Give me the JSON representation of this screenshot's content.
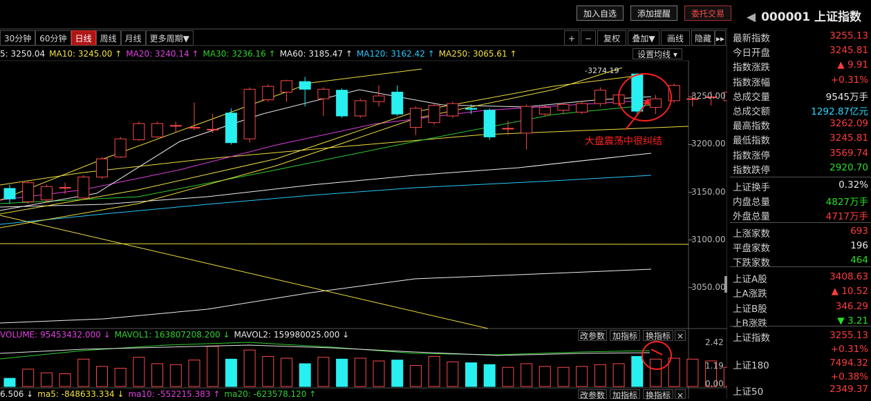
{
  "toolbar": {
    "add_watch": "加入自选",
    "add_alert": "添加提醒",
    "trade": "委托交易"
  },
  "security": {
    "code": "000001",
    "name": "上证指数"
  },
  "tabs": [
    {
      "label": "30分钟"
    },
    {
      "label": "60分钟"
    },
    {
      "label": "日线",
      "active": true
    },
    {
      "label": "周线"
    },
    {
      "label": "月线"
    },
    {
      "label": "更多周期▼"
    }
  ],
  "right_tools": {
    "plus": "+",
    "minus": "−",
    "restore": "复权",
    "overlay": "叠加▼",
    "draw": "画线",
    "hide": "隐藏",
    "more": "▸▸"
  },
  "ma_line": [
    {
      "text": "5: 3250.04",
      "color": "#e8e8e8"
    },
    {
      "text": "MA10: 3245.00 ↑",
      "color": "#f0e040"
    },
    {
      "text": "MA20: 3240.14 ↑",
      "color": "#e040e0"
    },
    {
      "text": "MA30: 3236.16 ↑",
      "color": "#30d030"
    },
    {
      "text": "MA60: 3185.47 ↑",
      "color": "#e8e8e8"
    },
    {
      "text": "MA120: 3162.42 ↑",
      "color": "#28c8ff"
    },
    {
      "text": "MA250: 3065.61 ↑",
      "color": "#f0e040"
    }
  ],
  "ma_settings": "设置均线 ▾",
  "price_ticks": [
    "3250.00",
    "3200.00",
    "3150.00",
    "3100.00",
    "3050.00"
  ],
  "high_label": "3274.19",
  "annotation": "大盘震荡中很纠结",
  "volume_line": [
    {
      "text": "VOLUME: 95453432.000 ↓",
      "color": "#e040e0"
    },
    {
      "text": "MAVOL1: 163807208.200 ↓",
      "color": "#30d030"
    },
    {
      "text": "MAVOL2: 159980025.000 ↓",
      "color": "#e8e8e8"
    }
  ],
  "volume_ticks": [
    "2.42",
    "1.19",
    "0.00"
  ],
  "bottom_line": [
    {
      "text": "6.506 ↓",
      "color": "#e8e8e8"
    },
    {
      "text": "ma5: -848633.334 ↓",
      "color": "#f0e040"
    },
    {
      "text": "ma10: -552215.383 ↑",
      "color": "#e040e0"
    },
    {
      "text": "ma20: -623578.120 ↑",
      "color": "#30d030"
    }
  ],
  "mini_buttons": {
    "params": "改参数",
    "add_ind": "加指标",
    "swap_ind": "换指标",
    "close": "×"
  },
  "panel": [
    {
      "label": "最新指数",
      "value": "3255.13",
      "cls": "red"
    },
    {
      "label": "今日开盘",
      "value": "3245.81",
      "cls": "red"
    },
    {
      "label": "指数涨跌",
      "value": "▲ 9.91",
      "cls": "red"
    },
    {
      "label": "指数涨幅",
      "value": "+0.31%",
      "cls": "red"
    },
    {
      "label": "总成交量",
      "value": "9545万手",
      "cls": "white"
    },
    {
      "label": "总成交额",
      "value": "1292.87亿元",
      "cls": "cyan"
    },
    {
      "label": "最高指数",
      "value": "3262.09",
      "cls": "red"
    },
    {
      "label": "最低指数",
      "value": "3245.81",
      "cls": "red"
    },
    {
      "label": "指数涨停",
      "value": "3569.74",
      "cls": "red"
    },
    {
      "label": "指数跌停",
      "value": "2920.70",
      "cls": "green"
    },
    {
      "label": "上证换手",
      "value": "0.32%",
      "cls": "white"
    },
    {
      "label": "内盘总量",
      "value": "4827万手",
      "cls": "green"
    },
    {
      "label": "外盘总量",
      "value": "4717万手",
      "cls": "red"
    },
    {
      "label": "上涨家数",
      "value": "693",
      "cls": "red"
    },
    {
      "label": "平盘家数",
      "value": "196",
      "cls": "white"
    },
    {
      "label": "下跌家数",
      "value": "464",
      "cls": "green"
    },
    {
      "label": "上证A股",
      "value": "3408.63",
      "cls": "red"
    },
    {
      "label": "上A涨跌",
      "value": "▲ 10.52",
      "cls": "red"
    },
    {
      "label": "上证B股",
      "value": "346.29",
      "cls": "red"
    },
    {
      "label": "上B涨跌",
      "value": "▼ 3.21",
      "cls": "green"
    }
  ],
  "panel_bottom": [
    {
      "label": "上证指数",
      "value": "3255.13",
      "sub": "+0.31%"
    },
    {
      "label": "上证180",
      "value": "7494.32",
      "sub": "+0.38%"
    },
    {
      "label": "上证50",
      "value": "2349.37",
      "sub": ""
    }
  ],
  "chart_data": {
    "type": "candlestick",
    "price_range": [
      3010,
      3285
    ],
    "candles": [
      {
        "o": 3154,
        "c": 3143,
        "h": 3158,
        "l": 3138
      },
      {
        "o": 3140,
        "c": 3160,
        "h": 3162,
        "l": 3138
      },
      {
        "o": 3142,
        "c": 3156,
        "h": 3158,
        "l": 3139
      },
      {
        "o": 3155,
        "c": 3155,
        "h": 3160,
        "l": 3148
      },
      {
        "o": 3144,
        "c": 3166,
        "h": 3168,
        "l": 3143
      },
      {
        "o": 3166,
        "c": 3185,
        "h": 3187,
        "l": 3164
      },
      {
        "o": 3187,
        "c": 3206,
        "h": 3208,
        "l": 3186
      },
      {
        "o": 3205,
        "c": 3222,
        "h": 3224,
        "l": 3204
      },
      {
        "o": 3208,
        "c": 3222,
        "h": 3224,
        "l": 3207
      },
      {
        "o": 3220,
        "c": 3220,
        "h": 3224,
        "l": 3213
      },
      {
        "o": 3218,
        "c": 3218,
        "h": 3244,
        "l": 3215
      },
      {
        "o": 3216,
        "c": 3216,
        "h": 3232,
        "l": 3212
      },
      {
        "o": 3233,
        "c": 3202,
        "h": 3238,
        "l": 3200
      },
      {
        "o": 3206,
        "c": 3258,
        "h": 3260,
        "l": 3202
      },
      {
        "o": 3247,
        "c": 3261,
        "h": 3263,
        "l": 3245
      },
      {
        "o": 3255,
        "c": 3267,
        "h": 3268,
        "l": 3245
      },
      {
        "o": 3266,
        "c": 3258,
        "h": 3271,
        "l": 3240
      },
      {
        "o": 3248,
        "c": 3258,
        "h": 3260,
        "l": 3230
      },
      {
        "o": 3257,
        "c": 3230,
        "h": 3259,
        "l": 3228
      },
      {
        "o": 3230,
        "c": 3246,
        "h": 3248,
        "l": 3228
      },
      {
        "o": 3245,
        "c": 3251,
        "h": 3262,
        "l": 3240
      },
      {
        "o": 3255,
        "c": 3232,
        "h": 3262,
        "l": 3230
      },
      {
        "o": 3218,
        "c": 3238,
        "h": 3240,
        "l": 3210
      },
      {
        "o": 3223,
        "c": 3241,
        "h": 3243,
        "l": 3221
      },
      {
        "o": 3230,
        "c": 3243,
        "h": 3245,
        "l": 3228
      },
      {
        "o": 3238,
        "c": 3237,
        "h": 3242,
        "l": 3232
      },
      {
        "o": 3236,
        "c": 3208,
        "h": 3238,
        "l": 3205
      },
      {
        "o": 3217,
        "c": 3217,
        "h": 3225,
        "l": 3210
      },
      {
        "o": 3212,
        "c": 3240,
        "h": 3242,
        "l": 3195
      },
      {
        "o": 3232,
        "c": 3239,
        "h": 3241,
        "l": 3230
      },
      {
        "o": 3236,
        "c": 3242,
        "h": 3244,
        "l": 3232
      },
      {
        "o": 3234,
        "c": 3243,
        "h": 3245,
        "l": 3232
      },
      {
        "o": 3243,
        "c": 3257,
        "h": 3260,
        "l": 3240
      },
      {
        "o": 3243,
        "c": 3252,
        "h": 3254,
        "l": 3240
      },
      {
        "o": 3274,
        "c": 3235,
        "h": 3275,
        "l": 3232
      },
      {
        "o": 3239,
        "c": 3248,
        "h": 3252,
        "l": 3232
      },
      {
        "o": 3246,
        "c": 3262,
        "h": 3264,
        "l": 3244
      },
      {
        "o": 3248,
        "c": 3248,
        "h": 3254,
        "l": 3240
      },
      {
        "o": 3250,
        "c": 3250,
        "h": 3256,
        "l": 3241
      },
      {
        "o": 3246,
        "c": 3255,
        "h": 3262,
        "l": 3245
      }
    ],
    "volumes": [
      0.45,
      0.95,
      0.75,
      0.7,
      1.5,
      1.1,
      1.0,
      1.6,
      1.25,
      1.2,
      1.45,
      2.2,
      1.5,
      2.0,
      1.65,
      1.55,
      1.25,
      1.6,
      1.5,
      1.55,
      1.4,
      1.45,
      1.15,
      1.65,
      1.35,
      1.3,
      1.2,
      1.05,
      1.25,
      1.1,
      1.05,
      1.1,
      1.2,
      1.25,
      1.65,
      1.5,
      1.55,
      1.5,
      1.4,
      1.05
    ],
    "volume_range": [
      0,
      2.42
    ]
  }
}
